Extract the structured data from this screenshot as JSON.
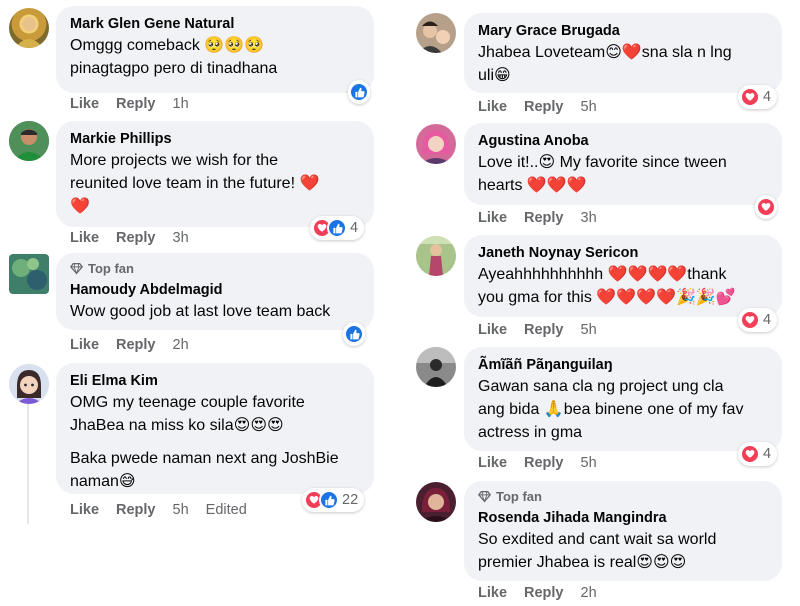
{
  "labels": {
    "like": "Like",
    "reply": "Reply",
    "top_fan": "Top fan"
  },
  "colors": {
    "bubble": "#f0f2f5",
    "meta_text": "#65676b",
    "like_blue": "#1b74e4",
    "love_red": "#f33e58",
    "heart": "#e41e3f"
  },
  "left": [
    {
      "author": "Mark Glen Gene Natural",
      "lines": [
        "Omggg comeback 🥺🥺🥺",
        "pinagtagpo pero di tinadhana"
      ],
      "time": "1h",
      "reactions": [
        "like-icon"
      ],
      "count": ""
    },
    {
      "author": "Markie Phillips",
      "lines": [
        "More projects we wish for the",
        "reunited love team in the future! ❤️",
        "❤️"
      ],
      "time": "3h",
      "reactions": [
        "love-icon",
        "like-icon"
      ],
      "count": "4"
    },
    {
      "top_fan": true,
      "author": "Hamoudy Abdelmagid",
      "lines": [
        "Wow good job at last love team back"
      ],
      "time": "2h",
      "reactions": [
        "like-icon"
      ],
      "count": ""
    },
    {
      "author": "Eli Elma Kim",
      "lines": [
        "OMG my teenage couple favorite",
        "JhaBea na miss ko sila😍😍😍"
      ],
      "lines2": [
        "Baka pwede naman next ang JoshBie",
        "naman😅"
      ],
      "time": "5h",
      "edited": "Edited",
      "reactions": [
        "love-icon",
        "like-icon"
      ],
      "count": "22"
    }
  ],
  "right": [
    {
      "author": "Mary Grace Brugada",
      "lines": [
        "Jhabea Loveteam😊❤️sna sla n lng",
        "uli😁"
      ],
      "time": "5h",
      "reactions": [
        "love-icon"
      ],
      "count": "4"
    },
    {
      "author": "Agustina Anoba",
      "lines": [
        "Love it!..😍 My favorite since tween",
        "hearts ❤️❤️❤️"
      ],
      "time": "3h",
      "reactions": [
        "love-icon"
      ],
      "count": ""
    },
    {
      "author": "Janeth Noynay Sericon",
      "lines": [
        "Ayeahhhhhhhhhh ❤️❤️❤️❤️thank",
        "you gma for this ❤️❤️❤️❤️🎉🎉💕"
      ],
      "time": "5h",
      "reactions": [
        "love-icon"
      ],
      "count": "4"
    },
    {
      "author": "Ãmĩãñ Pãŋanguilaŋ",
      "lines": [
        "Gawan sana cla ng project ung cla",
        "ang bida 🙏bea binene one of my fav",
        "actress in gma"
      ],
      "time": "5h",
      "reactions": [
        "love-icon"
      ],
      "count": "4"
    },
    {
      "top_fan": true,
      "author": "Rosenda Jihada Mangindra",
      "lines": [
        "So exdited and cant wait sa world",
        "premier Jhabea is real😍😍😍"
      ],
      "time": "2h",
      "reactions": [],
      "count": ""
    }
  ]
}
